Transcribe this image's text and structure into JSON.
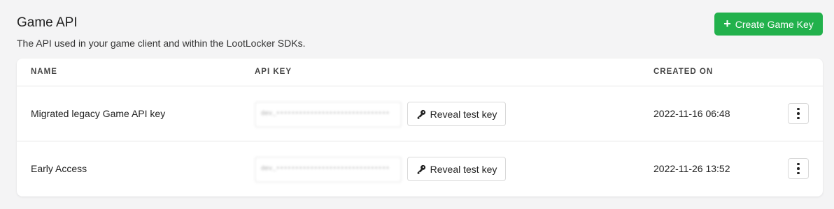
{
  "header": {
    "title": "Game API",
    "subtitle": "The API used in your game client and within the LootLocker SDKs.",
    "create_button_label": "Create Game Key",
    "create_button_icon": "plus-icon"
  },
  "table": {
    "columns": [
      "NAME",
      "API KEY",
      "CREATED ON"
    ],
    "rows": [
      {
        "name": "Migrated legacy Game API key",
        "api_key_masked": "dev_••••••••••••••••••••••••••••••",
        "reveal_label": "Reveal test key",
        "created_on": "2022-11-16 06:48"
      },
      {
        "name": "Early Access",
        "api_key_masked": "dev_••••••••••••••••••••••••••••••",
        "reveal_label": "Reveal test key",
        "created_on": "2022-11-26 13:52"
      }
    ]
  },
  "colors": {
    "accent_green": "#22b14c",
    "background": "#f4f4f5"
  },
  "icons": {
    "reveal": "key-icon",
    "row_menu": "more-vertical-icon"
  }
}
